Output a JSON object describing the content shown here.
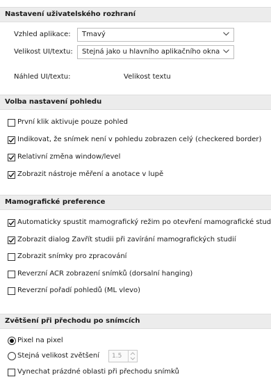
{
  "ui_settings": {
    "header": "Nastavení uživatelského rozhraní",
    "app_look_label": "Vzhled aplikace:",
    "app_look_value": "Tmavý",
    "ui_size_label": "Velikost UI/textu:",
    "ui_size_value": "Stejná jako u hlavního aplikačního okna",
    "preview_label": "Náhled UI/textu:",
    "preview_value": "Velikost textu"
  },
  "view_settings": {
    "header": "Volba nastavení pohledu",
    "items": [
      {
        "label": "První klik aktivuje pouze pohled",
        "checked": false
      },
      {
        "label": "Indikovat, že snímek není v pohledu zobrazen celý (checkered border)",
        "checked": true
      },
      {
        "label": "Relativní změna window/level",
        "checked": true
      },
      {
        "label": "Zobrazit nástroje měření a anotace v lupě",
        "checked": true
      }
    ]
  },
  "mammo": {
    "header": "Mamografické preference",
    "items": [
      {
        "label": "Automaticky spustit mamografický režim po otevření mamografické studie",
        "checked": true
      },
      {
        "label": "Zobrazit dialog Zavřít studii při zavírání mamografických studií",
        "checked": true
      },
      {
        "label": "Zobrazit snímky pro zpracování",
        "checked": false
      },
      {
        "label": "Reverzní ACR zobrazení snímků (dorsalní hanging)",
        "checked": false
      },
      {
        "label": "Reverzní pořadí pohledů (ML vlevo)",
        "checked": false
      }
    ]
  },
  "zoom": {
    "header": "Zvětšení při přechodu po snímcích",
    "radio_pixel": "Pixel na pixel",
    "radio_same": "Stejná velikost zvětšení",
    "same_value": "1.5",
    "skip_empty": "Vynechat prázdné oblasti při přechodu snímků"
  }
}
